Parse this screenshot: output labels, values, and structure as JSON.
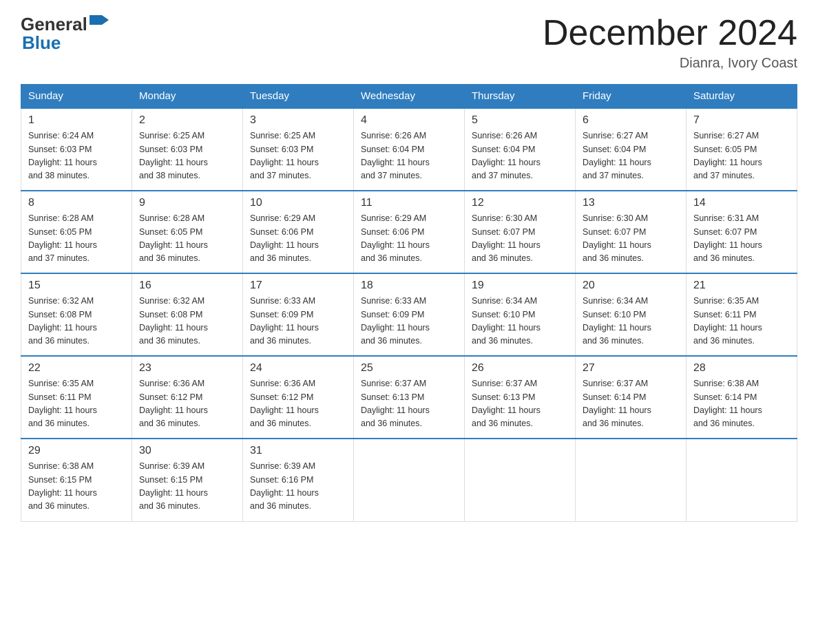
{
  "header": {
    "logo_general": "General",
    "logo_blue": "Blue",
    "month_year": "December 2024",
    "location": "Dianra, Ivory Coast"
  },
  "days_of_week": [
    "Sunday",
    "Monday",
    "Tuesday",
    "Wednesday",
    "Thursday",
    "Friday",
    "Saturday"
  ],
  "weeks": [
    [
      {
        "day": "1",
        "sunrise": "6:24 AM",
        "sunset": "6:03 PM",
        "daylight": "11 hours and 38 minutes."
      },
      {
        "day": "2",
        "sunrise": "6:25 AM",
        "sunset": "6:03 PM",
        "daylight": "11 hours and 38 minutes."
      },
      {
        "day": "3",
        "sunrise": "6:25 AM",
        "sunset": "6:03 PM",
        "daylight": "11 hours and 37 minutes."
      },
      {
        "day": "4",
        "sunrise": "6:26 AM",
        "sunset": "6:04 PM",
        "daylight": "11 hours and 37 minutes."
      },
      {
        "day": "5",
        "sunrise": "6:26 AM",
        "sunset": "6:04 PM",
        "daylight": "11 hours and 37 minutes."
      },
      {
        "day": "6",
        "sunrise": "6:27 AM",
        "sunset": "6:04 PM",
        "daylight": "11 hours and 37 minutes."
      },
      {
        "day": "7",
        "sunrise": "6:27 AM",
        "sunset": "6:05 PM",
        "daylight": "11 hours and 37 minutes."
      }
    ],
    [
      {
        "day": "8",
        "sunrise": "6:28 AM",
        "sunset": "6:05 PM",
        "daylight": "11 hours and 37 minutes."
      },
      {
        "day": "9",
        "sunrise": "6:28 AM",
        "sunset": "6:05 PM",
        "daylight": "11 hours and 36 minutes."
      },
      {
        "day": "10",
        "sunrise": "6:29 AM",
        "sunset": "6:06 PM",
        "daylight": "11 hours and 36 minutes."
      },
      {
        "day": "11",
        "sunrise": "6:29 AM",
        "sunset": "6:06 PM",
        "daylight": "11 hours and 36 minutes."
      },
      {
        "day": "12",
        "sunrise": "6:30 AM",
        "sunset": "6:07 PM",
        "daylight": "11 hours and 36 minutes."
      },
      {
        "day": "13",
        "sunrise": "6:30 AM",
        "sunset": "6:07 PM",
        "daylight": "11 hours and 36 minutes."
      },
      {
        "day": "14",
        "sunrise": "6:31 AM",
        "sunset": "6:07 PM",
        "daylight": "11 hours and 36 minutes."
      }
    ],
    [
      {
        "day": "15",
        "sunrise": "6:32 AM",
        "sunset": "6:08 PM",
        "daylight": "11 hours and 36 minutes."
      },
      {
        "day": "16",
        "sunrise": "6:32 AM",
        "sunset": "6:08 PM",
        "daylight": "11 hours and 36 minutes."
      },
      {
        "day": "17",
        "sunrise": "6:33 AM",
        "sunset": "6:09 PM",
        "daylight": "11 hours and 36 minutes."
      },
      {
        "day": "18",
        "sunrise": "6:33 AM",
        "sunset": "6:09 PM",
        "daylight": "11 hours and 36 minutes."
      },
      {
        "day": "19",
        "sunrise": "6:34 AM",
        "sunset": "6:10 PM",
        "daylight": "11 hours and 36 minutes."
      },
      {
        "day": "20",
        "sunrise": "6:34 AM",
        "sunset": "6:10 PM",
        "daylight": "11 hours and 36 minutes."
      },
      {
        "day": "21",
        "sunrise": "6:35 AM",
        "sunset": "6:11 PM",
        "daylight": "11 hours and 36 minutes."
      }
    ],
    [
      {
        "day": "22",
        "sunrise": "6:35 AM",
        "sunset": "6:11 PM",
        "daylight": "11 hours and 36 minutes."
      },
      {
        "day": "23",
        "sunrise": "6:36 AM",
        "sunset": "6:12 PM",
        "daylight": "11 hours and 36 minutes."
      },
      {
        "day": "24",
        "sunrise": "6:36 AM",
        "sunset": "6:12 PM",
        "daylight": "11 hours and 36 minutes."
      },
      {
        "day": "25",
        "sunrise": "6:37 AM",
        "sunset": "6:13 PM",
        "daylight": "11 hours and 36 minutes."
      },
      {
        "day": "26",
        "sunrise": "6:37 AM",
        "sunset": "6:13 PM",
        "daylight": "11 hours and 36 minutes."
      },
      {
        "day": "27",
        "sunrise": "6:37 AM",
        "sunset": "6:14 PM",
        "daylight": "11 hours and 36 minutes."
      },
      {
        "day": "28",
        "sunrise": "6:38 AM",
        "sunset": "6:14 PM",
        "daylight": "11 hours and 36 minutes."
      }
    ],
    [
      {
        "day": "29",
        "sunrise": "6:38 AM",
        "sunset": "6:15 PM",
        "daylight": "11 hours and 36 minutes."
      },
      {
        "day": "30",
        "sunrise": "6:39 AM",
        "sunset": "6:15 PM",
        "daylight": "11 hours and 36 minutes."
      },
      {
        "day": "31",
        "sunrise": "6:39 AM",
        "sunset": "6:16 PM",
        "daylight": "11 hours and 36 minutes."
      },
      null,
      null,
      null,
      null
    ]
  ],
  "labels": {
    "sunrise": "Sunrise:",
    "sunset": "Sunset:",
    "daylight": "Daylight:"
  }
}
